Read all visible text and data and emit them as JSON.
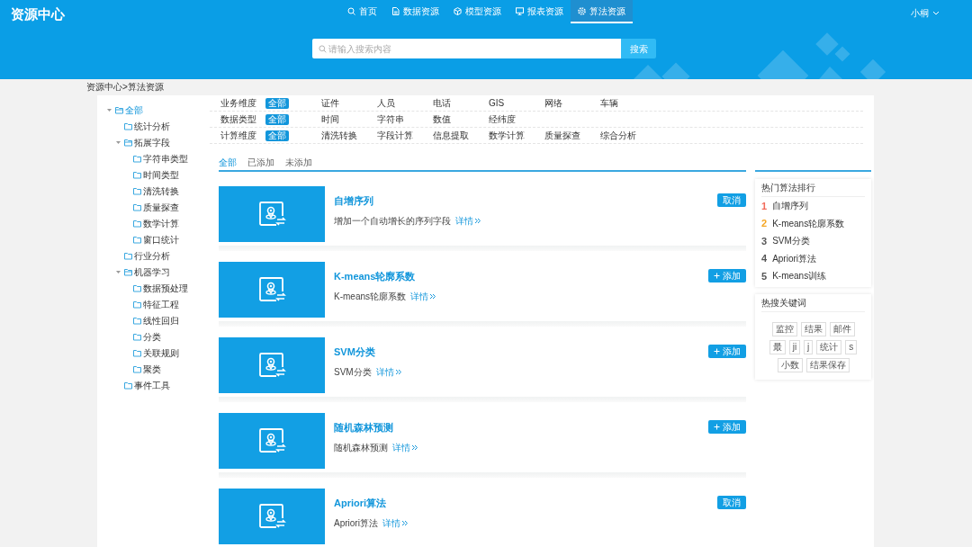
{
  "header": {
    "logo": "资源中心",
    "user": "小桐",
    "nav": [
      {
        "label": "首页",
        "selected": false
      },
      {
        "label": "数据资源",
        "selected": false
      },
      {
        "label": "模型资源",
        "selected": false
      },
      {
        "label": "报表资源",
        "selected": false
      },
      {
        "label": "算法资源",
        "selected": true
      }
    ],
    "search": {
      "placeholder": "请输入搜索内容",
      "button": "搜索"
    }
  },
  "breadcrumb": "资源中心>算法资源",
  "tree": [
    {
      "label": "全部",
      "selected": true,
      "expanded": true,
      "children": [
        {
          "label": "统计分析",
          "selected": false
        },
        {
          "label": "拓展字段",
          "selected": false,
          "expanded": true,
          "children": [
            {
              "label": "字符串类型",
              "selected": false
            },
            {
              "label": "时间类型",
              "selected": false
            },
            {
              "label": "清洗转换",
              "selected": false
            },
            {
              "label": "质量探查",
              "selected": false
            },
            {
              "label": "数学计算",
              "selected": false
            },
            {
              "label": "窗口统计",
              "selected": false
            }
          ]
        },
        {
          "label": "行业分析",
          "selected": false
        },
        {
          "label": "机器学习",
          "selected": false,
          "expanded": true,
          "children": [
            {
              "label": "数据预处理",
              "selected": false
            },
            {
              "label": "特征工程",
              "selected": false
            },
            {
              "label": "线性回归",
              "selected": false
            },
            {
              "label": "分类",
              "selected": false
            },
            {
              "label": "关联规则",
              "selected": false
            },
            {
              "label": "聚类",
              "selected": false
            }
          ]
        },
        {
          "label": "事件工具",
          "selected": false
        }
      ]
    }
  ],
  "filters": [
    {
      "label": "业务维度",
      "options": [
        {
          "label": "全部",
          "selected": true
        },
        {
          "label": "证件",
          "selected": false
        },
        {
          "label": "人员",
          "selected": false
        },
        {
          "label": "电话",
          "selected": false
        },
        {
          "label": "GIS",
          "selected": false
        },
        {
          "label": "网络",
          "selected": false
        },
        {
          "label": "车辆",
          "selected": false
        }
      ]
    },
    {
      "label": "数据类型",
      "options": [
        {
          "label": "全部",
          "selected": true
        },
        {
          "label": "时间",
          "selected": false
        },
        {
          "label": "字符串",
          "selected": false
        },
        {
          "label": "数值",
          "selected": false
        },
        {
          "label": "经纬度",
          "selected": false
        }
      ]
    },
    {
      "label": "计算维度",
      "options": [
        {
          "label": "全部",
          "selected": true
        },
        {
          "label": "清洗转换",
          "selected": false
        },
        {
          "label": "字段计算",
          "selected": false
        },
        {
          "label": "信息提取",
          "selected": false
        },
        {
          "label": "数学计算",
          "selected": false
        },
        {
          "label": "质量探查",
          "selected": false
        },
        {
          "label": "综合分析",
          "selected": false
        }
      ]
    }
  ],
  "tabs": [
    {
      "label": "全部",
      "selected": true
    },
    {
      "label": "已添加",
      "selected": false
    },
    {
      "label": "未添加",
      "selected": false
    }
  ],
  "cards": [
    {
      "title": "自增序列",
      "description": "增加一个自动增长的序列字段",
      "link": "详情",
      "action": {
        "kind": "cancel",
        "label": "取消"
      }
    },
    {
      "title": "K-means轮廓系数",
      "description": "K-means轮廓系数",
      "link": "详情",
      "action": {
        "kind": "add",
        "label": "添加"
      }
    },
    {
      "title": "SVM分类",
      "description": "SVM分类",
      "link": "详情",
      "action": {
        "kind": "add",
        "label": "添加"
      }
    },
    {
      "title": "随机森林预测",
      "description": "随机森林预测",
      "link": "详情",
      "action": {
        "kind": "add",
        "label": "添加"
      }
    },
    {
      "title": "Apriori算法",
      "description": "Apriori算法",
      "link": "详情",
      "action": {
        "kind": "cancel",
        "label": "取消"
      }
    }
  ],
  "ranking": {
    "title": "热门算法排行",
    "items": [
      {
        "rank": "1",
        "name": "自增序列",
        "color": "#f26b5b"
      },
      {
        "rank": "2",
        "name": "K-means轮廓系数",
        "color": "#f5a623"
      },
      {
        "rank": "3",
        "name": "SVM分类",
        "color": "#555555"
      },
      {
        "rank": "4",
        "name": "Apriori算法",
        "color": "#555555"
      },
      {
        "rank": "5",
        "name": "K-means训练",
        "color": "#555555"
      }
    ]
  },
  "keywords": {
    "title": "热搜关键词",
    "tags": [
      "监控",
      "结果",
      "邮件",
      "最",
      "ji",
      "j",
      "统计",
      "s",
      "小数",
      "结果保存"
    ]
  }
}
